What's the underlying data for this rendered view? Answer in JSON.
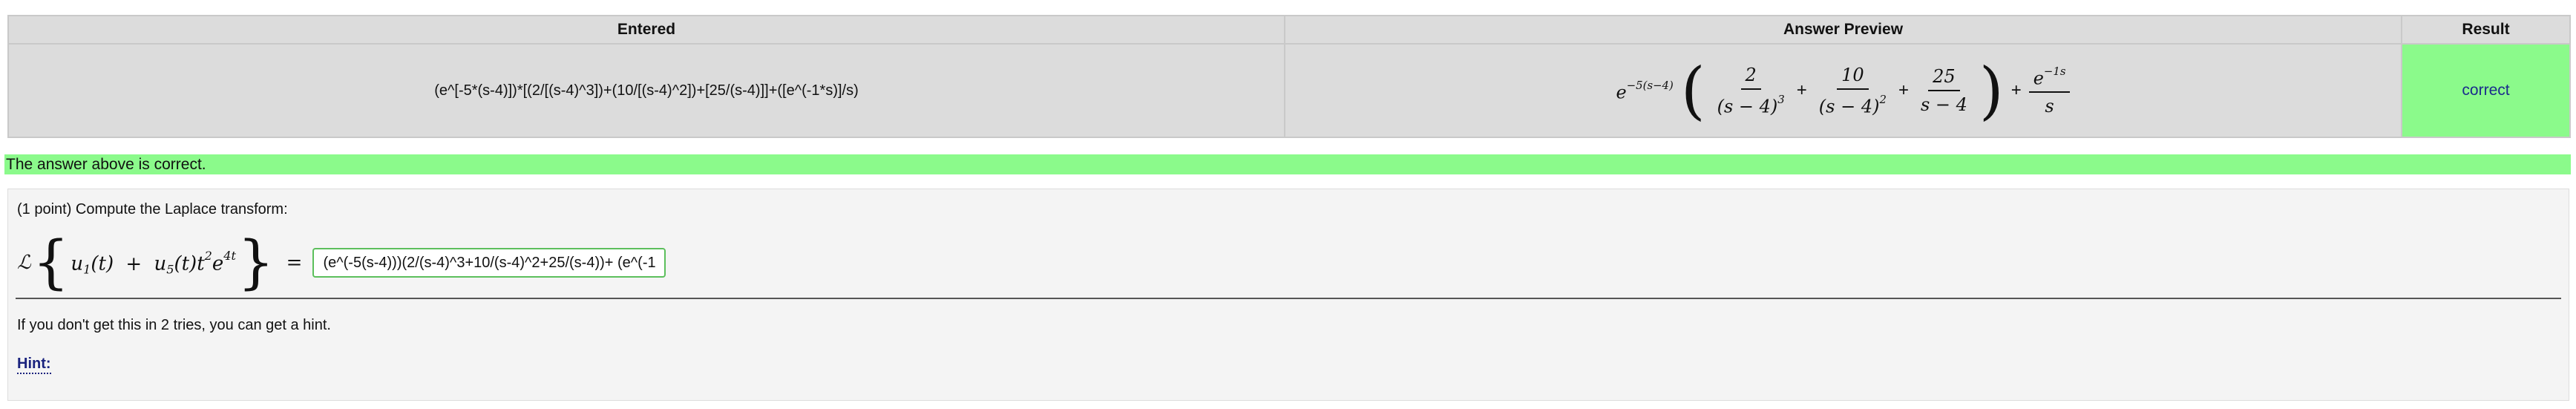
{
  "results_table": {
    "headers": {
      "entered": "Entered",
      "answer_preview": "Answer Preview",
      "result": "Result"
    },
    "row": {
      "entered": "(e^[-5*(s-4)])*[(2/[(s-4)^3])+(10/[(s-4)^2])+[25/(s-4)]]+([e^(-1*s)]/s)",
      "preview": {
        "exp_base": "e",
        "exp_power": "−5(s−4)",
        "term1_num": "2",
        "term1_den": "(s − 4)",
        "term1_pow": "3",
        "term2_num": "10",
        "term2_den": "(s − 4)",
        "term2_pow": "2",
        "term3_num": "25",
        "term3_den": "s − 4",
        "term4_num_base": "e",
        "term4_num_pow": "−1s",
        "term4_den": "s",
        "plus": "+"
      },
      "result": "correct"
    }
  },
  "banner": {
    "text": "The answer above is correct."
  },
  "problem": {
    "intro": "(1 point) Compute the Laplace transform:",
    "equation": {
      "operator": "ℒ",
      "u1": "u",
      "u1_sub": "1",
      "t1": "(t)",
      "plus": "+",
      "u5": "u",
      "u5_sub": "5",
      "t5": "(t)t",
      "t_pow": "2",
      "e": "e",
      "e_pow": "4t",
      "equals": "="
    },
    "answer_value": "(e^(-5(s-4)))(2/(s-4)^3+10/(s-4)^2+25/(s-4))+ (e^(-1",
    "hint_text": "If you don't get this in 2 tries, you can get a hint.",
    "hint_link": "Hint:"
  },
  "colors": {
    "correct_bg": "#8bfa8b",
    "table_bg": "#dcdcdc",
    "link": "#1a237e",
    "input_border": "#5cbf5c"
  }
}
